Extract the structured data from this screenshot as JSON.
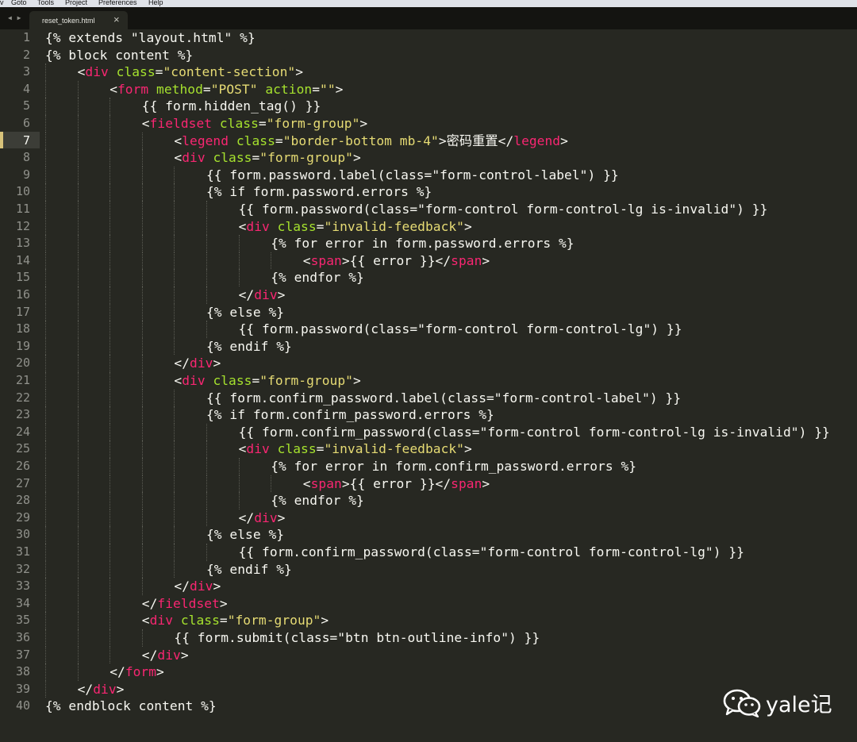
{
  "menu": [
    "v",
    "Goto",
    "Tools",
    "Project",
    "Preferences",
    "Help"
  ],
  "tabs": {
    "nav": "◀ ▶",
    "active_title": "reset_token.html",
    "close_glyph": "×"
  },
  "editor": {
    "current_line": 7,
    "colors": {
      "background": "#272822",
      "tag": "#f92672",
      "attribute": "#a6e22e",
      "string": "#e6db74",
      "text": "#f8f8f2",
      "line_number": "#90918b"
    },
    "lines": [
      {
        "n": "1",
        "indent": 0,
        "tokens": [
          [
            "txt",
            "{% extends \"layout.html\" %}"
          ]
        ]
      },
      {
        "n": "2",
        "indent": 0,
        "tokens": [
          [
            "txt",
            "{% block content %}"
          ]
        ]
      },
      {
        "n": "3",
        "indent": 1,
        "tokens": [
          [
            "pun",
            "<"
          ],
          [
            "tag",
            "div"
          ],
          [
            "txt",
            " "
          ],
          [
            "attr",
            "class"
          ],
          [
            "pun",
            "="
          ],
          [
            "str",
            "\"content-section\""
          ],
          [
            "pun",
            ">"
          ]
        ]
      },
      {
        "n": "4",
        "indent": 2,
        "tokens": [
          [
            "pun",
            "<"
          ],
          [
            "tag",
            "form"
          ],
          [
            "txt",
            " "
          ],
          [
            "attr",
            "method"
          ],
          [
            "pun",
            "="
          ],
          [
            "str",
            "\"POST\""
          ],
          [
            "txt",
            " "
          ],
          [
            "attr",
            "action"
          ],
          [
            "pun",
            "="
          ],
          [
            "str",
            "\"\""
          ],
          [
            "pun",
            ">"
          ]
        ]
      },
      {
        "n": "5",
        "indent": 3,
        "tokens": [
          [
            "txt",
            "{{ form.hidden_tag() }}"
          ]
        ]
      },
      {
        "n": "6",
        "indent": 3,
        "tokens": [
          [
            "pun",
            "<"
          ],
          [
            "tag",
            "fieldset"
          ],
          [
            "txt",
            " "
          ],
          [
            "attr",
            "class"
          ],
          [
            "pun",
            "="
          ],
          [
            "str",
            "\"form-group\""
          ],
          [
            "pun",
            ">"
          ]
        ]
      },
      {
        "n": "7",
        "indent": 4,
        "tokens": [
          [
            "pun",
            "<"
          ],
          [
            "tag",
            "legend"
          ],
          [
            "txt",
            " "
          ],
          [
            "attr",
            "class"
          ],
          [
            "pun",
            "="
          ],
          [
            "str",
            "\"border-bottom mb-4\""
          ],
          [
            "pun",
            ">"
          ],
          [
            "txt",
            "密码重置"
          ],
          [
            "pun",
            "</"
          ],
          [
            "tag",
            "legend"
          ],
          [
            "pun",
            ">"
          ]
        ]
      },
      {
        "n": "8",
        "indent": 4,
        "tokens": [
          [
            "pun",
            "<"
          ],
          [
            "tag",
            "div"
          ],
          [
            "txt",
            " "
          ],
          [
            "attr",
            "class"
          ],
          [
            "pun",
            "="
          ],
          [
            "str",
            "\"form-group\""
          ],
          [
            "pun",
            ">"
          ]
        ]
      },
      {
        "n": "9",
        "indent": 5,
        "tokens": [
          [
            "txt",
            "{{ form.password.label(class=\"form-control-label\") }}"
          ]
        ]
      },
      {
        "n": "10",
        "indent": 5,
        "tokens": [
          [
            "txt",
            "{% if form.password.errors %}"
          ]
        ]
      },
      {
        "n": "11",
        "indent": 6,
        "tokens": [
          [
            "txt",
            "{{ form.password(class=\"form-control form-control-lg is-invalid\") }}"
          ]
        ]
      },
      {
        "n": "12",
        "indent": 6,
        "tokens": [
          [
            "pun",
            "<"
          ],
          [
            "tag",
            "div"
          ],
          [
            "txt",
            " "
          ],
          [
            "attr",
            "class"
          ],
          [
            "pun",
            "="
          ],
          [
            "str",
            "\"invalid-feedback\""
          ],
          [
            "pun",
            ">"
          ]
        ]
      },
      {
        "n": "13",
        "indent": 7,
        "tokens": [
          [
            "txt",
            "{% for error in form.password.errors %}"
          ]
        ]
      },
      {
        "n": "14",
        "indent": 8,
        "tokens": [
          [
            "pun",
            "<"
          ],
          [
            "tag",
            "span"
          ],
          [
            "pun",
            ">"
          ],
          [
            "txt",
            "{{ error }}"
          ],
          [
            "pun",
            "</"
          ],
          [
            "tag",
            "span"
          ],
          [
            "pun",
            ">"
          ]
        ]
      },
      {
        "n": "15",
        "indent": 7,
        "tokens": [
          [
            "txt",
            "{% endfor %}"
          ]
        ]
      },
      {
        "n": "16",
        "indent": 6,
        "tokens": [
          [
            "pun",
            "</"
          ],
          [
            "tag",
            "div"
          ],
          [
            "pun",
            ">"
          ]
        ]
      },
      {
        "n": "17",
        "indent": 5,
        "tokens": [
          [
            "txt",
            "{% else %}"
          ]
        ]
      },
      {
        "n": "18",
        "indent": 6,
        "tokens": [
          [
            "txt",
            "{{ form.password(class=\"form-control form-control-lg\") }}"
          ]
        ]
      },
      {
        "n": "19",
        "indent": 5,
        "tokens": [
          [
            "txt",
            "{% endif %}"
          ]
        ]
      },
      {
        "n": "20",
        "indent": 4,
        "tokens": [
          [
            "pun",
            "</"
          ],
          [
            "tag",
            "div"
          ],
          [
            "pun",
            ">"
          ]
        ]
      },
      {
        "n": "21",
        "indent": 4,
        "tokens": [
          [
            "pun",
            "<"
          ],
          [
            "tag",
            "div"
          ],
          [
            "txt",
            " "
          ],
          [
            "attr",
            "class"
          ],
          [
            "pun",
            "="
          ],
          [
            "str",
            "\"form-group\""
          ],
          [
            "pun",
            ">"
          ]
        ]
      },
      {
        "n": "22",
        "indent": 5,
        "tokens": [
          [
            "txt",
            "{{ form.confirm_password.label(class=\"form-control-label\") }}"
          ]
        ]
      },
      {
        "n": "23",
        "indent": 5,
        "tokens": [
          [
            "txt",
            "{% if form.confirm_password.errors %}"
          ]
        ]
      },
      {
        "n": "24",
        "indent": 6,
        "tokens": [
          [
            "txt",
            "{{ form.confirm_password(class=\"form-control form-control-lg is-invalid\") }}"
          ]
        ]
      },
      {
        "n": "25",
        "indent": 6,
        "tokens": [
          [
            "pun",
            "<"
          ],
          [
            "tag",
            "div"
          ],
          [
            "txt",
            " "
          ],
          [
            "attr",
            "class"
          ],
          [
            "pun",
            "="
          ],
          [
            "str",
            "\"invalid-feedback\""
          ],
          [
            "pun",
            ">"
          ]
        ]
      },
      {
        "n": "26",
        "indent": 7,
        "tokens": [
          [
            "txt",
            "{% for error in form.confirm_password.errors %}"
          ]
        ]
      },
      {
        "n": "27",
        "indent": 8,
        "tokens": [
          [
            "pun",
            "<"
          ],
          [
            "tag",
            "span"
          ],
          [
            "pun",
            ">"
          ],
          [
            "txt",
            "{{ error }}"
          ],
          [
            "pun",
            "</"
          ],
          [
            "tag",
            "span"
          ],
          [
            "pun",
            ">"
          ]
        ]
      },
      {
        "n": "28",
        "indent": 7,
        "tokens": [
          [
            "txt",
            "{% endfor %}"
          ]
        ]
      },
      {
        "n": "29",
        "indent": 6,
        "tokens": [
          [
            "pun",
            "</"
          ],
          [
            "tag",
            "div"
          ],
          [
            "pun",
            ">"
          ]
        ]
      },
      {
        "n": "30",
        "indent": 5,
        "tokens": [
          [
            "txt",
            "{% else %}"
          ]
        ]
      },
      {
        "n": "31",
        "indent": 6,
        "tokens": [
          [
            "txt",
            "{{ form.confirm_password(class=\"form-control form-control-lg\") }}"
          ]
        ]
      },
      {
        "n": "32",
        "indent": 5,
        "tokens": [
          [
            "txt",
            "{% endif %}"
          ]
        ]
      },
      {
        "n": "33",
        "indent": 4,
        "tokens": [
          [
            "pun",
            "</"
          ],
          [
            "tag",
            "div"
          ],
          [
            "pun",
            ">"
          ]
        ]
      },
      {
        "n": "34",
        "indent": 3,
        "tokens": [
          [
            "pun",
            "</"
          ],
          [
            "tag",
            "fieldset"
          ],
          [
            "pun",
            ">"
          ]
        ]
      },
      {
        "n": "35",
        "indent": 3,
        "tokens": [
          [
            "pun",
            "<"
          ],
          [
            "tag",
            "div"
          ],
          [
            "txt",
            " "
          ],
          [
            "attr",
            "class"
          ],
          [
            "pun",
            "="
          ],
          [
            "str",
            "\"form-group\""
          ],
          [
            "pun",
            ">"
          ]
        ]
      },
      {
        "n": "36",
        "indent": 4,
        "tokens": [
          [
            "txt",
            "{{ form.submit(class=\"btn btn-outline-info\") }}"
          ]
        ]
      },
      {
        "n": "37",
        "indent": 3,
        "tokens": [
          [
            "pun",
            "</"
          ],
          [
            "tag",
            "div"
          ],
          [
            "pun",
            ">"
          ]
        ]
      },
      {
        "n": "38",
        "indent": 2,
        "tokens": [
          [
            "pun",
            "</"
          ],
          [
            "tag",
            "form"
          ],
          [
            "pun",
            ">"
          ]
        ]
      },
      {
        "n": "39",
        "indent": 1,
        "tokens": [
          [
            "pun",
            "</"
          ],
          [
            "tag",
            "div"
          ],
          [
            "pun",
            ">"
          ]
        ]
      },
      {
        "n": "40",
        "indent": 0,
        "tokens": [
          [
            "txt",
            "{% endblock content %}"
          ]
        ]
      }
    ]
  },
  "watermark": {
    "icon": "wechat-icon",
    "text": "yale记"
  }
}
